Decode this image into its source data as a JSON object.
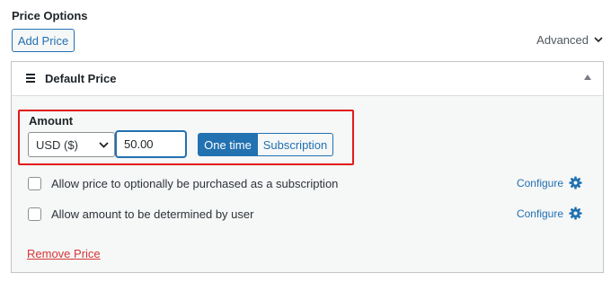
{
  "section": {
    "title": "Price Options"
  },
  "toolbar": {
    "add_price_label": "Add Price",
    "advanced_label": "Advanced",
    "advanced_icon": "chevron-down-icon"
  },
  "price": {
    "header_title": "Default Price",
    "handle_icon": "drag-handle-icon",
    "collapse_icon": "triangle-up-icon",
    "amount": {
      "label": "Amount",
      "currency_value": "USD ($)",
      "amount_value": "50.00",
      "type_options": [
        {
          "label": "One time",
          "selected": true
        },
        {
          "label": "Subscription",
          "selected": false
        }
      ]
    },
    "options": [
      {
        "label": "Allow price to optionally be purchased as a subscription",
        "checked": false,
        "configure_label": "Configure",
        "configure_icon": "gear-icon"
      },
      {
        "label": "Allow amount to be determined by user",
        "checked": false,
        "configure_label": "Configure",
        "configure_icon": "gear-icon"
      }
    ],
    "remove_label": "Remove Price"
  },
  "colors": {
    "accent": "#2271b1",
    "danger": "#d63638",
    "highlight_border": "#e01b1b",
    "panel_bg": "#f6f7f7"
  }
}
